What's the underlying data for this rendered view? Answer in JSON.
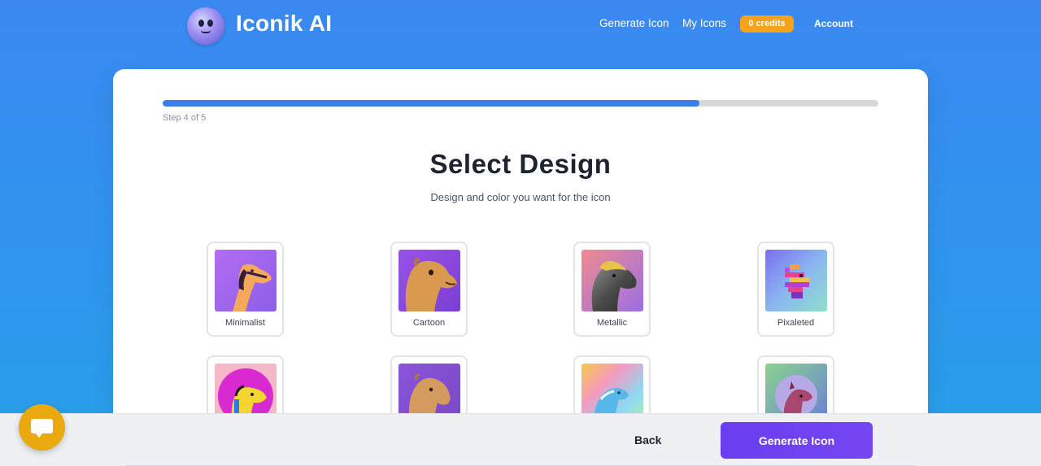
{
  "header": {
    "brand": "Iconik AI",
    "nav": {
      "generate_icon": "Generate Icon",
      "my_icons": "My Icons",
      "credits": "0 credits",
      "account": "Account"
    }
  },
  "wizard": {
    "progress_fraction": 0.75,
    "step_label": "Step 4 of 5",
    "title": "Select Design",
    "subtitle": "Design and color you want for the icon",
    "designs": [
      {
        "label": "Minimalist",
        "icon": "camel-minimalist"
      },
      {
        "label": "Cartoon",
        "icon": "camel-cartoon"
      },
      {
        "label": "Metallic",
        "icon": "camel-metallic"
      },
      {
        "label": "Pixaleted",
        "icon": "camel-pixelated"
      },
      {
        "label": "",
        "icon": "camel-pop-art"
      },
      {
        "label": "",
        "icon": "camel-realistic"
      },
      {
        "label": "",
        "icon": "camel-holographic"
      },
      {
        "label": "",
        "icon": "camel-3d-portrait"
      }
    ]
  },
  "footer": {
    "back": "Back",
    "generate": "Generate Icon"
  },
  "colors": {
    "accent": "#3b7ee8",
    "primary_button": "#6a3df0",
    "credits_badge": "#f6a21a",
    "chat_button": "#e9a90f"
  }
}
